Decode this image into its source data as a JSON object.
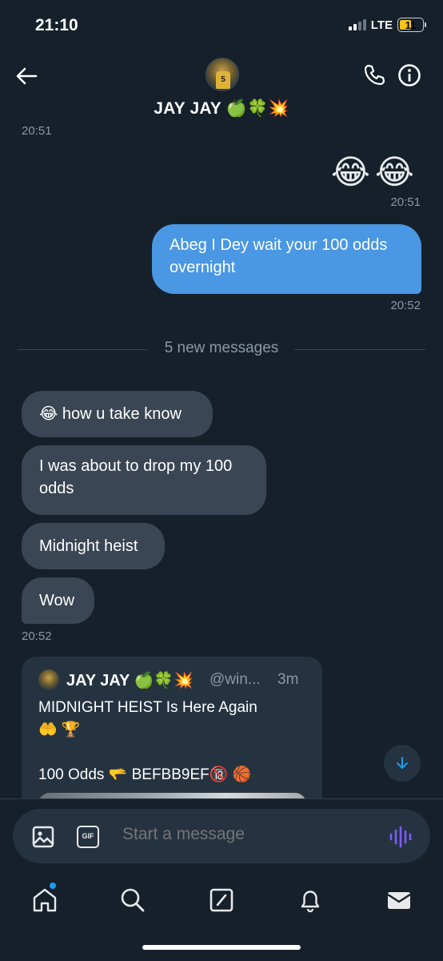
{
  "status_bar": {
    "time": "21:10",
    "network": "LTE",
    "battery": "11"
  },
  "header": {
    "title": "JAY JAY 🍏🍀💥",
    "avatar_jersey": "5"
  },
  "messages": {
    "peek_time": "20:51",
    "emoji_message": "😂😂",
    "emoji_time": "20:51",
    "sent_text": "Abeg I Dey wait your 100 odds overnight",
    "sent_time": "20:52",
    "new_messages_divider": "5 new messages",
    "received": [
      "😂 how u take know",
      "I was about to drop my 100 odds",
      "Midnight heist",
      "Wow"
    ],
    "received_time": "20:52"
  },
  "shared_post": {
    "name": "JAY JAY 🍏🍀💥",
    "handle": "@win...",
    "time": "3m",
    "text": "MIDNIGHT HEIST Is Here Again\n🤲 🏆\n\n100 Odds 🫳 BEFBB9EF🔞 🏀"
  },
  "composer": {
    "placeholder": "Start a message",
    "gif_label": "GIF"
  },
  "colors": {
    "background": "#15202b",
    "sent_bubble": "#4a97e3",
    "received_bubble": "#3a4653",
    "accent": "#1d9bf0",
    "voice": "#7c5cff"
  },
  "icons": [
    "back-arrow-icon",
    "phone-icon",
    "info-icon",
    "media-icon",
    "gif-icon",
    "voice-icon",
    "scroll-down-icon",
    "home-icon",
    "search-icon",
    "compose-icon",
    "bell-icon",
    "mail-icon"
  ]
}
